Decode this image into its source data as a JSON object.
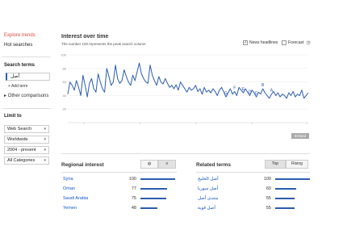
{
  "sidebar": {
    "explore_trends": "Explore trends",
    "hot_searches": "Hot searches",
    "search_terms_header": "Search terms",
    "search_term_value": "أصل",
    "add_term": "+ Add term",
    "other_comparisons": "▸ Other comparisons",
    "limit_to_header": "Limit to",
    "selects": [
      "Web Search",
      "Worldwide",
      "2004 - present",
      "All Categories"
    ]
  },
  "main": {
    "title": "Interest over time",
    "subtitle": "The number 100 represents the peak search volume",
    "news_headlines_label": "News headlines",
    "news_headlines_checked": true,
    "forecast_label": "Forecast",
    "forecast_checked": false,
    "embed_label": "Embed"
  },
  "chart_data": {
    "type": "line",
    "y_ticks": [
      "100",
      "80",
      "60",
      "40",
      "20"
    ],
    "ylim": [
      0,
      100
    ],
    "grid": true,
    "color": "#2a5db0",
    "news_markers": [
      "G",
      "F",
      "E",
      "D",
      "C",
      "B",
      "A"
    ],
    "values": [
      42,
      60,
      55,
      48,
      62,
      52,
      40,
      70,
      55,
      38,
      58,
      65,
      50,
      45,
      72,
      60,
      50,
      45,
      80,
      68,
      55,
      60,
      85,
      65,
      58,
      62,
      78,
      68,
      60,
      55,
      70,
      62,
      75,
      88,
      72,
      65,
      60,
      58,
      85,
      70,
      62,
      55,
      68,
      60,
      57,
      65,
      58,
      52,
      55,
      50,
      56,
      48,
      60,
      55,
      50,
      45,
      52,
      48,
      50,
      55,
      46,
      50,
      42,
      52,
      45,
      48,
      44,
      50,
      46,
      40,
      48,
      52,
      45,
      38,
      44,
      50,
      42,
      46,
      40,
      52,
      48,
      44,
      50,
      45,
      40,
      48,
      44,
      38,
      45,
      42,
      50,
      44,
      40,
      36,
      42,
      46,
      40,
      44,
      38,
      42,
      40,
      36,
      44,
      40,
      46,
      38,
      42,
      40,
      48,
      36,
      40,
      44
    ]
  },
  "regional": {
    "title": "Regional interest",
    "rows": [
      {
        "label": "Syria",
        "value": 100
      },
      {
        "label": "Oman",
        "value": 77
      },
      {
        "label": "Saudi Arabia",
        "value": 75
      },
      {
        "label": "Yemen",
        "value": 48
      }
    ]
  },
  "related": {
    "title": "Related terms",
    "top_label": "Top",
    "rising_label": "Rising",
    "rows": [
      {
        "label": "أصل الخليج",
        "value": 100
      },
      {
        "label": "أصل سوريا",
        "value": 60
      },
      {
        "label": "منتدى أصل",
        "value": 55
      },
      {
        "label": "أصل قوية",
        "value": 55
      }
    ]
  }
}
